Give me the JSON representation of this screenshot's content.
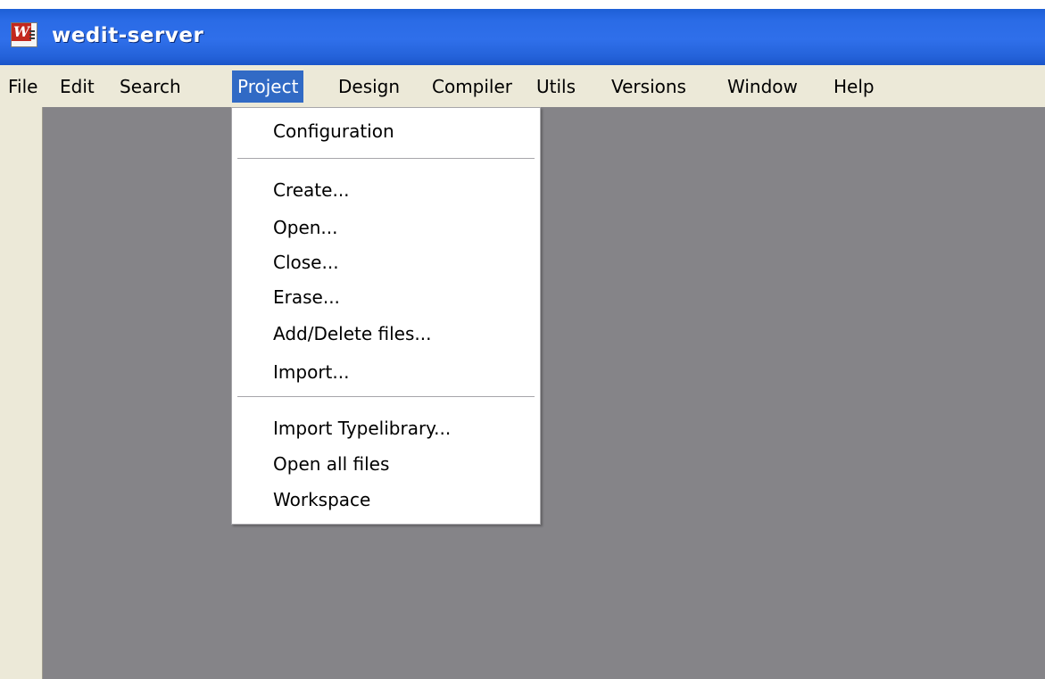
{
  "window": {
    "title": "wedit-server",
    "icon": "wedit-app-icon",
    "icon_letter": "W"
  },
  "menubar": {
    "items": [
      {
        "label": "File"
      },
      {
        "label": "Edit"
      },
      {
        "label": "Search"
      },
      {
        "label": "Project",
        "active": true
      },
      {
        "label": "Design"
      },
      {
        "label": "Compiler"
      },
      {
        "label": "Utils"
      },
      {
        "label": "Versions"
      },
      {
        "label": "Window"
      },
      {
        "label": "Help"
      }
    ]
  },
  "project_menu": {
    "groups": [
      [
        "Configuration"
      ],
      [
        "Create...",
        "Open...",
        "Close...",
        "Erase...",
        "Add/Delete files...",
        "Import..."
      ],
      [
        "Import Typelibrary...",
        "Open all files",
        "Workspace"
      ]
    ]
  },
  "colors": {
    "titlebar": "#2f6fea",
    "menu_highlight": "#316ac5",
    "workspace": "#858488",
    "chrome": "#ece9d8"
  }
}
